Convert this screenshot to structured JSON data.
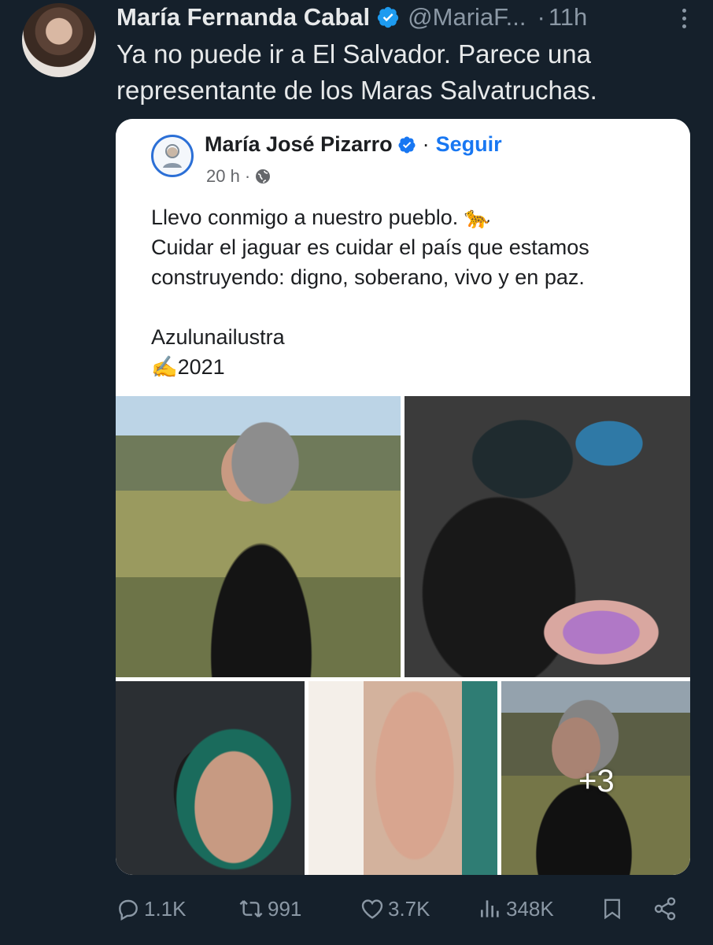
{
  "tweet": {
    "author_name": "María Fernanda Cabal",
    "handle": "@MariaF...",
    "time_sep": "·",
    "time": "11h",
    "text_lines": [
      "Ya no puede ir a El Salvador. Parece una",
      "representante de los Maras Salvatruchas."
    ]
  },
  "embedded_post": {
    "author_name": "María José Pizarro",
    "separator": "·",
    "follow_label": "Seguir",
    "time": "20 h ·",
    "text_lines": [
      "Llevo conmigo a nuestro pueblo. 🐆",
      "Cuidar el jaguar es cuidar el país que estamos",
      "construyendo: digno, soberano, vivo y en paz.",
      "",
      "Azulunailustra",
      "✍️2021"
    ],
    "more_photos_label": "+3"
  },
  "actions": {
    "replies": "1.1K",
    "retweets": "991",
    "likes": "3.7K",
    "views": "348K"
  },
  "colors": {
    "background": "#15202b",
    "verified": "#1d9bf0",
    "fb_link": "#1877f2",
    "muted": "#8b98a5"
  },
  "icons": [
    "verified-badge-icon",
    "more-icon",
    "globe-icon",
    "reply-icon",
    "retweet-icon",
    "like-icon",
    "views-icon",
    "bookmark-icon",
    "share-icon"
  ]
}
